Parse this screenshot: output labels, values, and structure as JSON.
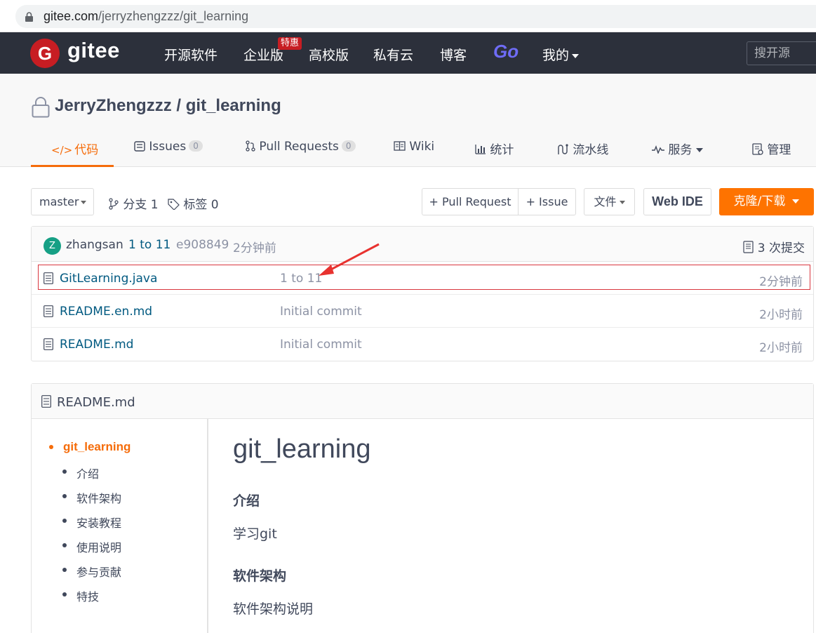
{
  "browser": {
    "url_host": "gitee.com",
    "url_path": "/jerryzhengzzz/git_learning"
  },
  "topnav": {
    "logo_text": "gitee",
    "logo_letter": "G",
    "items": [
      "开源软件",
      "企业版",
      "高校版",
      "私有云",
      "博客"
    ],
    "badge": "特惠",
    "go_label": "Go",
    "mine_label": "我的",
    "search_placeholder": "搜开源"
  },
  "repo": {
    "owner": "JerryZhengzzz",
    "separator": " / ",
    "name": "git_learning",
    "tabs": [
      {
        "label": "代码",
        "icon": "</>"
      },
      {
        "label": "Issues",
        "count": "0"
      },
      {
        "label": "Pull Requests",
        "count": "0"
      },
      {
        "label": "Wiki"
      },
      {
        "label": "统计"
      },
      {
        "label": "流水线"
      },
      {
        "label": "服务"
      },
      {
        "label": "管理"
      }
    ]
  },
  "toolbar": {
    "branch": "master",
    "branches_label": "分支 1",
    "tags_label": "标签 0",
    "pull_request_btn": "+ Pull Request",
    "issue_btn": "+ Issue",
    "file_btn": "文件",
    "webide_btn": "Web IDE",
    "clone_btn": "克隆/下载"
  },
  "last_commit": {
    "avatar_letter": "Z",
    "author": "zhangsan",
    "message": "1 to 11",
    "sha": "e908849",
    "time": "2分钟前",
    "commit_count": "3 次提交"
  },
  "files": [
    {
      "name": "GitLearning.java",
      "commit": "1 to 11",
      "time": "2分钟前"
    },
    {
      "name": "README.en.md",
      "commit": "Initial commit",
      "time": "2小时前"
    },
    {
      "name": "README.md",
      "commit": "Initial commit",
      "time": "2小时前"
    }
  ],
  "readme": {
    "filename": "README.md",
    "toc": [
      "git_learning",
      "介绍",
      "软件架构",
      "安装教程",
      "使用说明",
      "参与贡献",
      "特技"
    ],
    "h1": "git_learning",
    "section1_title": "介绍",
    "section1_text": "学习git",
    "section2_title": "软件架构",
    "section2_text": "软件架构说明"
  },
  "colors": {
    "accent": "#f56c0a",
    "nav_bg": "#2c303b",
    "clone_bg": "#fe7300",
    "link": "#005980",
    "highlight": "#d9363e"
  }
}
